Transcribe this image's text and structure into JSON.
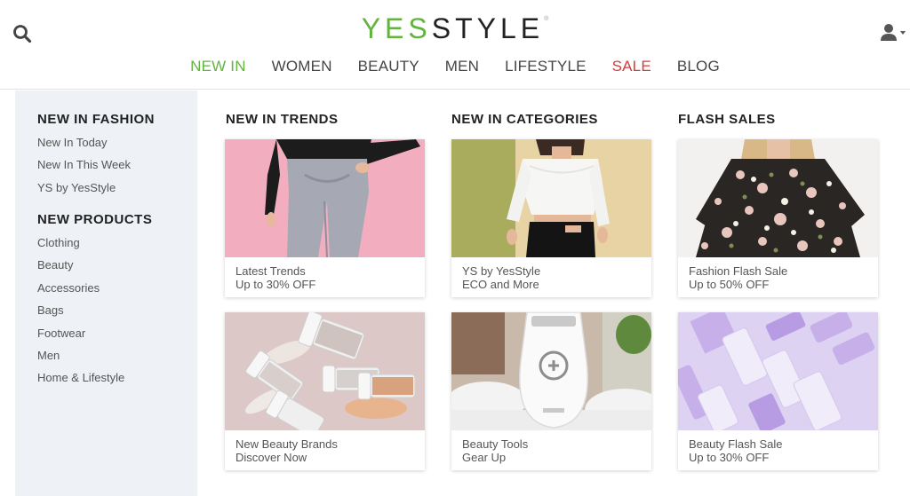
{
  "header": {
    "logo_left": "YES",
    "logo_right": "STYLE",
    "logo_mark": "®",
    "search_icon": "search-icon",
    "user_icon": "user-icon"
  },
  "nav": {
    "items": [
      "NEW IN",
      "WOMEN",
      "BEAUTY",
      "MEN",
      "LIFESTYLE",
      "SALE",
      "BLOG"
    ],
    "active_color": "#62b43e",
    "sale_color": "#d83a3a"
  },
  "left_panel": {
    "fashion_heading": "NEW IN FASHION",
    "fashion_items": [
      "New In Today",
      "New In This Week",
      "YS by YesStyle"
    ],
    "products_heading": "NEW PRODUCTS",
    "products_items": [
      "Clothing",
      "Beauty",
      "Accessories",
      "Bags",
      "Footwear",
      "Men",
      "Home & Lifestyle"
    ]
  },
  "columns": [
    {
      "title": "NEW IN TRENDS",
      "cards": [
        {
          "line1": "Latest Trends",
          "line2": "Up to 30% OFF"
        },
        {
          "line1": "New Beauty Brands",
          "line2": "Discover Now"
        }
      ]
    },
    {
      "title": "NEW IN CATEGORIES",
      "cards": [
        {
          "line1": "YS by YesStyle",
          "line2": "ECO and More"
        },
        {
          "line1": "Beauty Tools",
          "line2": "Gear Up"
        }
      ]
    },
    {
      "title": "FLASH SALES",
      "cards": [
        {
          "line1": "Fashion Flash Sale",
          "line2": "Up to 50% OFF"
        },
        {
          "line1": "Beauty Flash Sale",
          "line2": "Up to 30% OFF"
        }
      ]
    }
  ],
  "colors": {
    "brand_green": "#62b43e",
    "sale_red": "#d83a3a",
    "panel_bg": "#eef1f5"
  }
}
